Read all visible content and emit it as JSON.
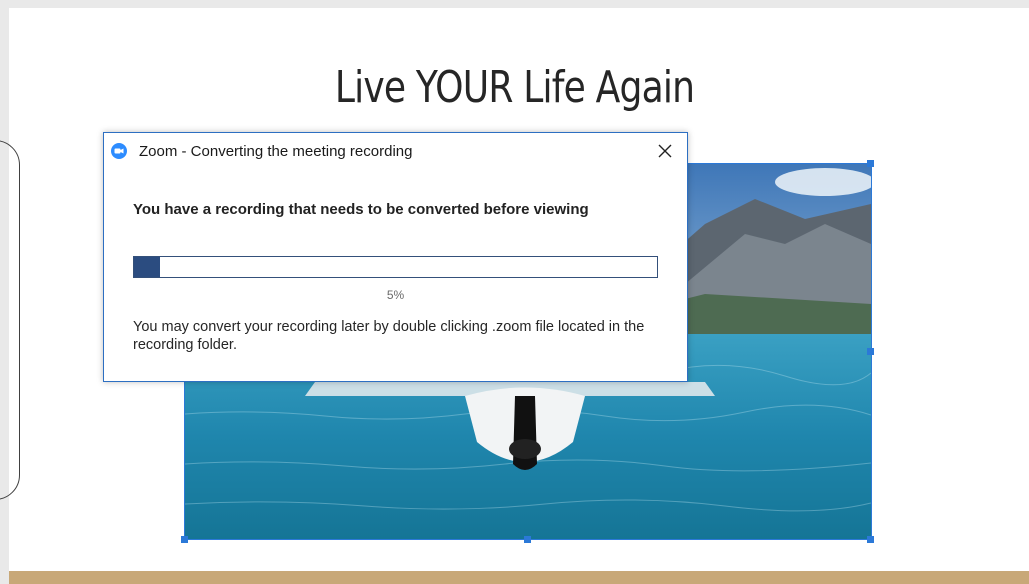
{
  "slide": {
    "title": "Live YOUR Life Again"
  },
  "dialog": {
    "title": "Zoom - Converting the meeting recording",
    "heading": "You have a recording that needs to be converted before viewing",
    "progress_fraction": 0.05,
    "progress_label": "5%",
    "note": "You may convert your recording later by double clicking .zoom file located in the recording folder.",
    "icon": "zoom-camera-icon",
    "close_icon": "close-icon"
  },
  "colors": {
    "accent_blue": "#2b79d8",
    "progress_fill": "#2b4c80",
    "bottom_band": "#c8a878"
  }
}
